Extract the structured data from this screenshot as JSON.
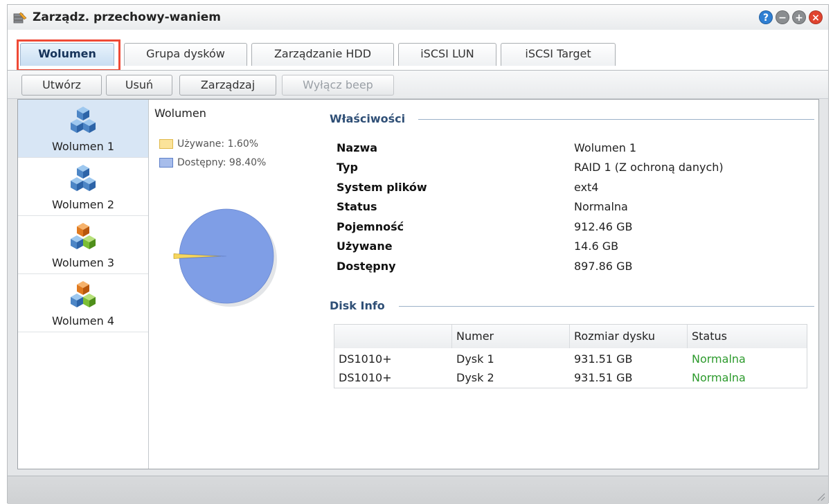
{
  "window": {
    "title": "Zarządz. przechowy-waniem",
    "app_icon": "storage-manager-icon"
  },
  "window_buttons": [
    {
      "name": "help-icon",
      "glyph": "?",
      "color": "#2f7fd3"
    },
    {
      "name": "minimize-icon",
      "glyph": "−",
      "color": "#8a8d90"
    },
    {
      "name": "maximize-icon",
      "glyph": "+",
      "color": "#8a8d90"
    },
    {
      "name": "close-icon",
      "glyph": "×",
      "color": "#e0432f"
    }
  ],
  "tabs": [
    {
      "label": "Wolumen",
      "active": true
    },
    {
      "label": "Grupa dysków",
      "active": false
    },
    {
      "label": "Zarządzanie HDD",
      "active": false
    },
    {
      "label": "iSCSI LUN",
      "active": false
    },
    {
      "label": "iSCSI Target",
      "active": false
    }
  ],
  "toolbar": {
    "create": "Utwórz",
    "delete": "Usuń",
    "manage": "Zarządzaj",
    "beep": "Wyłącz beep"
  },
  "volumes": [
    {
      "label": "Wolumen 1",
      "icon": "blue-cubes-icon",
      "selected": true
    },
    {
      "label": "Wolumen 2",
      "icon": "blue-cubes-icon",
      "selected": false
    },
    {
      "label": "Wolumen 3",
      "icon": "color-cubes-icon",
      "selected": false
    },
    {
      "label": "Wolumen 4",
      "icon": "color-cubes-icon",
      "selected": false
    }
  ],
  "chart": {
    "title": "Wolumen",
    "legend_used": "Używane: 1.60%",
    "legend_free": "Dostępny: 98.40%"
  },
  "chart_data": {
    "type": "pie",
    "categories": [
      "Używane",
      "Dostępny"
    ],
    "values": [
      1.6,
      98.4
    ],
    "colors": [
      "#f6d65e",
      "#7f9ee6"
    ],
    "title": "Wolumen",
    "legend_placement": "top-left"
  },
  "properties": {
    "section_title": "Właściwości",
    "rows": [
      {
        "key": "Nazwa",
        "value": "Wolumen 1"
      },
      {
        "key": "Typ",
        "value": "RAID 1 (Z ochroną danych)"
      },
      {
        "key": "System plików",
        "value": "ext4"
      },
      {
        "key": "Status",
        "value": "Normalna"
      },
      {
        "key": "Pojemność",
        "value": "912.46 GB"
      },
      {
        "key": "Używane",
        "value": "14.6 GB"
      },
      {
        "key": "Dostępny",
        "value": "897.86 GB"
      }
    ]
  },
  "disk_info": {
    "section_title": "Disk Info",
    "headers": [
      "",
      "Numer",
      "Rozmiar dysku",
      "Status"
    ],
    "rows": [
      {
        "device": "DS1010+",
        "number": "Dysk 1",
        "size": "931.51 GB",
        "status": "Normalna"
      },
      {
        "device": "DS1010+",
        "number": "Dysk 2",
        "size": "931.51 GB",
        "status": "Normalna"
      }
    ]
  },
  "colors": {
    "status_ok": "#2c9a2c",
    "highlight": "#ef4a36",
    "section_title": "#2f4f76"
  }
}
